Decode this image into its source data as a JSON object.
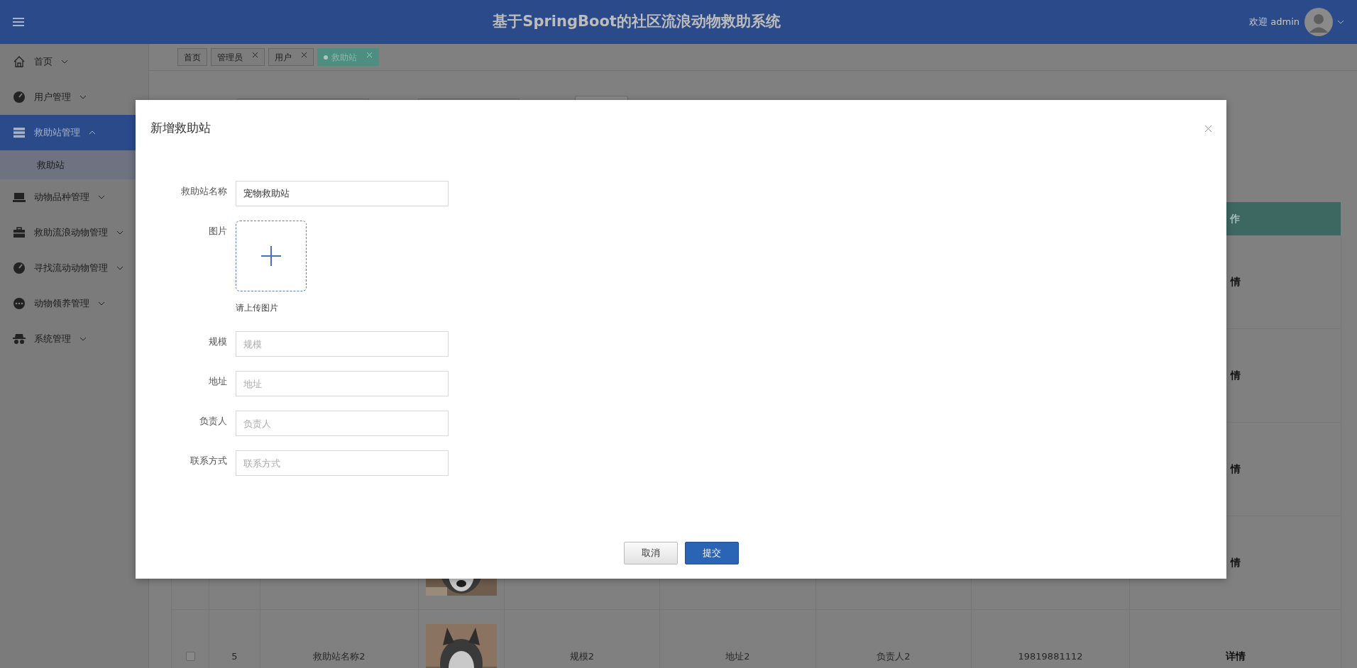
{
  "header": {
    "title": "基于SpringBoot的社区流浪动物救助系统",
    "welcome": "欢迎 admin"
  },
  "sidebar": {
    "items": [
      {
        "label": "首页",
        "selected": false,
        "expanded": false
      },
      {
        "label": "用户管理",
        "selected": false,
        "expanded": false
      },
      {
        "label": "救助站管理",
        "selected": true,
        "expanded": true,
        "children": [
          {
            "label": "救助站",
            "selected": true
          }
        ]
      },
      {
        "label": "动物品种管理",
        "selected": false,
        "expanded": false
      },
      {
        "label": "救助流浪动物管理",
        "selected": false,
        "expanded": false
      },
      {
        "label": "寻找流动动物管理",
        "selected": false,
        "expanded": false
      },
      {
        "label": "动物领养管理",
        "selected": false,
        "expanded": false
      },
      {
        "label": "系统管理",
        "selected": false,
        "expanded": false
      }
    ]
  },
  "tabs": [
    {
      "label": "首页",
      "closable": false,
      "selected": false
    },
    {
      "label": "管理员",
      "closable": true,
      "selected": false
    },
    {
      "label": "用户",
      "closable": true,
      "selected": false
    },
    {
      "label": "救助站",
      "closable": true,
      "selected": true
    }
  ],
  "table": {
    "operation_header": "作",
    "rows": [
      {
        "operation": "情"
      },
      {
        "operation": "情"
      },
      {
        "operation": "情"
      },
      {
        "operation": "情"
      },
      {
        "checked": false,
        "index": "5",
        "name": "救助站名称2",
        "scale": "规模2",
        "address": "地址2",
        "manager": "负责人2",
        "phone": "19819881112",
        "operation": "详情"
      }
    ]
  },
  "modal": {
    "title": "新增救助站",
    "fields": [
      {
        "kind": "text",
        "label": "救助站名称",
        "value": "宠物救助站"
      },
      {
        "kind": "upload",
        "label": "图片",
        "hint": "请上传图片"
      },
      {
        "kind": "text",
        "label": "规模",
        "placeholder": "规模"
      },
      {
        "kind": "text",
        "label": "地址",
        "placeholder": "地址"
      },
      {
        "kind": "text",
        "label": "负责人",
        "placeholder": "负责人"
      },
      {
        "kind": "text",
        "label": "联系方式",
        "placeholder": "联系方式"
      }
    ],
    "buttons": [
      {
        "label": "取消",
        "kind": "secondary"
      },
      {
        "label": "提交",
        "kind": "primary"
      }
    ]
  }
}
